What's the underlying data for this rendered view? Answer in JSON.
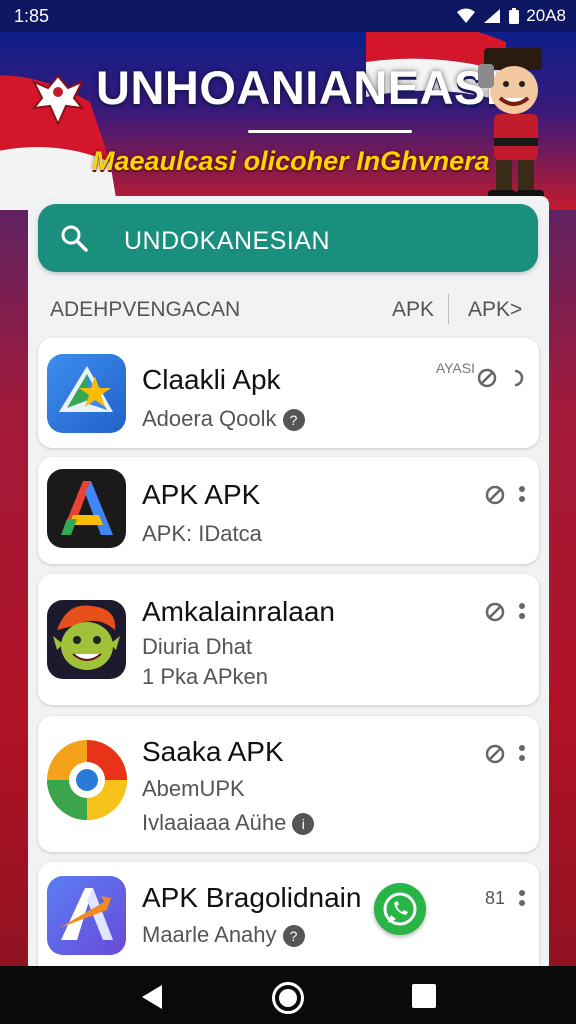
{
  "status_bar": {
    "time": "1:85",
    "right_text": "20A8"
  },
  "banner": {
    "title": "UNHOANIANEASIA",
    "subtitle": "Maeaulcasi olicoher InGhvnera"
  },
  "search": {
    "value": "UNDOKANESIAN"
  },
  "section": {
    "label": "ADEHPVENGACAN",
    "apk_1": "APK",
    "apk_2": "APK>"
  },
  "apps": [
    {
      "name": "Claakli Apk",
      "subtitle": "Adoera Qoolk",
      "badge": "AYASI",
      "icon": "maps-star-icon"
    },
    {
      "name": "APK APK",
      "subtitle": "APK: IDatca",
      "icon": "colorful-a-icon"
    },
    {
      "name": "Amkalainralaan",
      "subtitle": "Diuria Dhat",
      "subtitle_2": "1 Pka APken",
      "icon": "goblin-character-icon"
    },
    {
      "name": "Saaka APK",
      "subtitle": "AbemUPK",
      "subtitle_2": "Ivlaaiaaa Aühe",
      "icon": "swirl-orb-icon"
    },
    {
      "name": "APK Bragolidnain",
      "subtitle": "Maarle Anahy",
      "badge": "81",
      "icon": "blue-a-arrow-icon"
    }
  ],
  "colors": {
    "accent": "#1a8f7d",
    "whatsapp": "#28b446"
  }
}
